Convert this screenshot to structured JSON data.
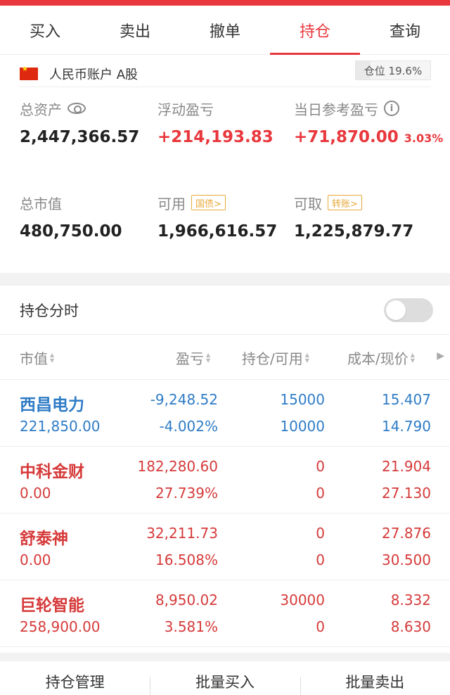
{
  "tabs": [
    "买入",
    "卖出",
    "撤单",
    "持仓",
    "查询"
  ],
  "active_tab": "持仓",
  "account": {
    "label": "人民币账户 A股",
    "position_ratio_text": "仓位 19.6%",
    "position_ratio": 0.196
  },
  "summary": {
    "total_assets": {
      "label": "总资产",
      "value": "2,447,366.57"
    },
    "floating_pl": {
      "label": "浮动盈亏",
      "value": "+214,193.83"
    },
    "daily_pl": {
      "label": "当日参考盈亏",
      "value": "+71,870.00",
      "pct": "3.03%"
    },
    "market_value": {
      "label": "总市值",
      "value": "480,750.00"
    },
    "available": {
      "label": "可用",
      "value": "1,966,616.57",
      "tag": "国债>"
    },
    "withdrawable": {
      "label": "可取",
      "value": "1,225,879.77",
      "tag": "转账>"
    }
  },
  "timeline": {
    "label": "持仓分时",
    "enabled": false
  },
  "table": {
    "headers": [
      "市值",
      "盈亏",
      "持仓/可用",
      "成本/现价"
    ],
    "rows": [
      {
        "name": "西昌电力",
        "market_value": "221,850.00",
        "pl": "-9,248.52",
        "pl_pct": "-4.002%",
        "holding": "15000",
        "available": "10000",
        "cost": "15.407",
        "price": "14.790",
        "color": "#2e7cc6"
      },
      {
        "name": "中科金财",
        "market_value": "0.00",
        "pl": "182,280.60",
        "pl_pct": "27.739%",
        "holding": "0",
        "available": "0",
        "cost": "21.904",
        "price": "27.130",
        "color": "#d63a3a"
      },
      {
        "name": "舒泰神",
        "market_value": "0.00",
        "pl": "32,211.73",
        "pl_pct": "16.508%",
        "holding": "0",
        "available": "0",
        "cost": "27.876",
        "price": "30.500",
        "color": "#d63a3a"
      },
      {
        "name": "巨轮智能",
        "market_value": "258,900.00",
        "pl": "8,950.02",
        "pl_pct": "3.581%",
        "holding": "30000",
        "available": "0",
        "cost": "8.332",
        "price": "8.630",
        "color": "#d63a3a"
      }
    ]
  },
  "bottom_actions": [
    "持仓管理",
    "批量买入",
    "批量卖出"
  ],
  "colors": {
    "accent": "#e8383d",
    "loss": "#2e7cc6",
    "gain": "#d63a3a",
    "tag": "#e8a93a"
  }
}
